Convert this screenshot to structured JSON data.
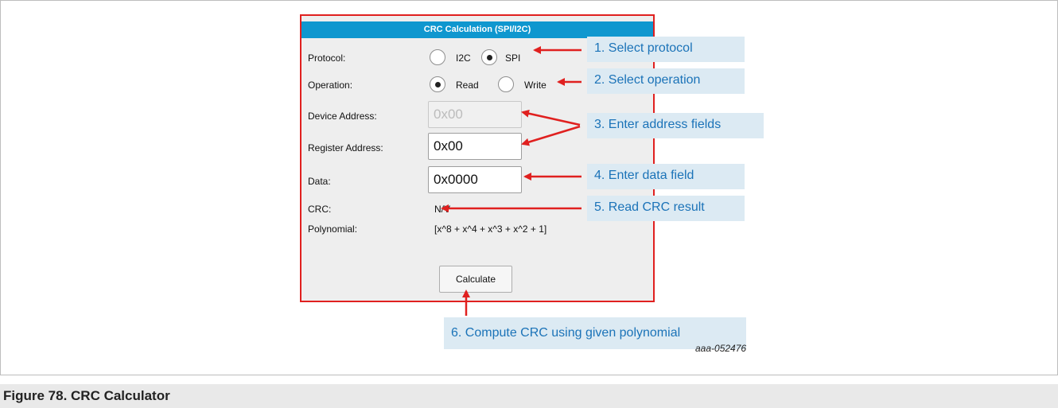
{
  "dialog": {
    "title": "CRC Calculation (SPI/I2C)",
    "protocol_label": "Protocol:",
    "protocol_options": [
      "I2C",
      "SPI"
    ],
    "protocol_selected": "SPI",
    "operation_label": "Operation:",
    "operation_options": [
      "Read",
      "Write"
    ],
    "operation_selected": "Read",
    "device_address_label": "Device Address:",
    "device_address_value": "0x00",
    "register_address_label": "Register Address:",
    "register_address_value": "0x00",
    "data_label": "Data:",
    "data_value": "0x0000",
    "crc_label": "CRC:",
    "crc_value": "N/V",
    "polynomial_label": "Polynomial:",
    "polynomial_value": "[x^8 + x^4 + x^3 + x^2 + 1]",
    "calculate_label": "Calculate"
  },
  "callouts": [
    "1. Select protocol",
    "2. Select operation",
    "3. Enter address fields",
    "4. Enter data field",
    "5. Read CRC result",
    "6. Compute CRC using given polynomial"
  ],
  "figure_ref": "aaa-052476",
  "caption": "Figure 78.  CRC Calculator",
  "colors": {
    "annotation": "#e0201f",
    "title_bar": "#0f97cf",
    "callout_bg": "#dceaf3",
    "callout_text": "#1b73b8"
  }
}
